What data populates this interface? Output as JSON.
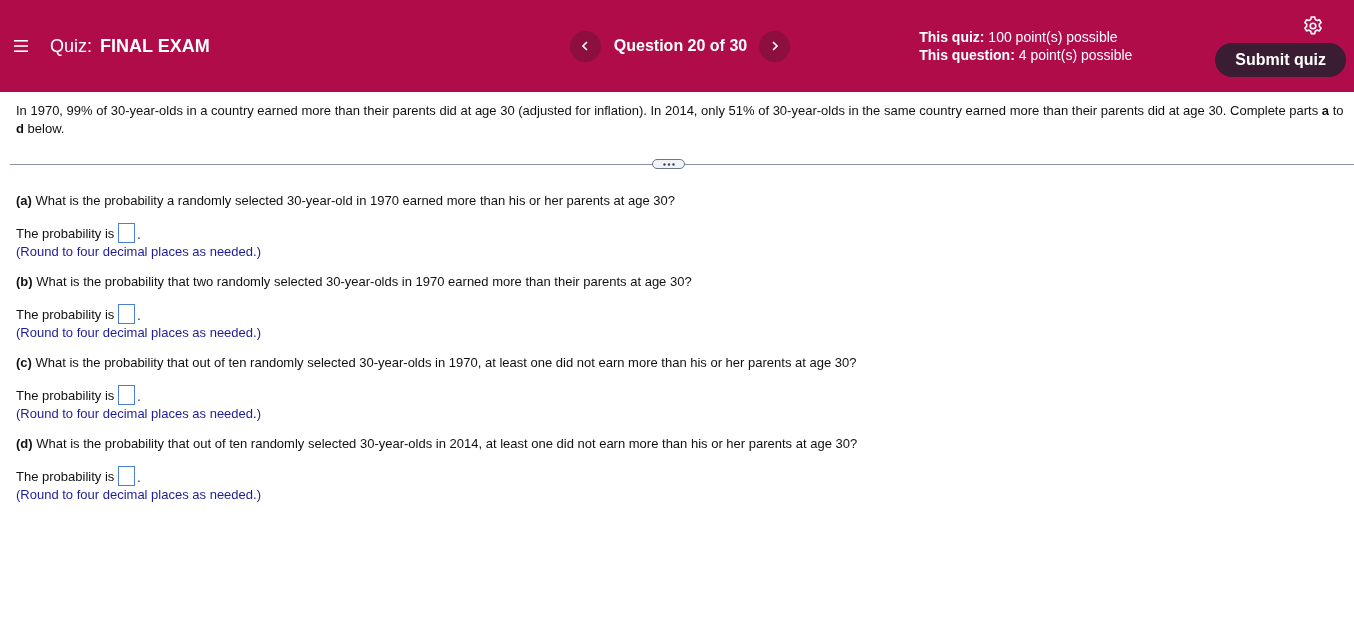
{
  "header": {
    "quiz_label": "Quiz:",
    "quiz_title": "FINAL EXAM",
    "question_counter": "Question 20 of 30",
    "points": [
      "**This quiz:** 100 point(s) possible",
      "**This question:** 4 point(s) possible"
    ],
    "submit_button": "Submit quiz"
  },
  "intro": "In 1970, 99% of 30-year-olds in a country earned more than their parents did at age 30 (adjusted for inflation). In 2014, only 51% of 30-year-olds in the same country earned more than their parents did at age 30. Complete parts **a** to **d** below.",
  "parts": [
    {
      "question": "**(a)** What is the probability a randomly selected 30-year-old in 1970 earned more than his or her parents at age 30?",
      "answer_prefix": "The probability is",
      "answer_suffix": ".",
      "hint": "(Round to four decimal places as needed.)"
    },
    {
      "question": "**(b)** What is the probability that two randomly selected 30-year-olds in 1970 earned more than their parents at age 30?",
      "answer_prefix": "The probability is",
      "answer_suffix": ".",
      "hint": "(Round to four decimal places as needed.)"
    },
    {
      "question": "**(c)** What is the probability that out of ten randomly selected 30-year-olds in 1970, at least one did not earn more than his or her parents at age 30?",
      "answer_prefix": "The probability is",
      "answer_suffix": ".",
      "hint": "(Round to four decimal places as needed.)"
    },
    {
      "question": "**(d)** What is the probability that out of ten randomly selected 30-year-olds in 2014, at least one did not earn more than his or her parents at age 30?",
      "answer_prefix": "The probability is",
      "answer_suffix": ".",
      "hint": "(Round to four decimal places as needed.)"
    }
  ]
}
